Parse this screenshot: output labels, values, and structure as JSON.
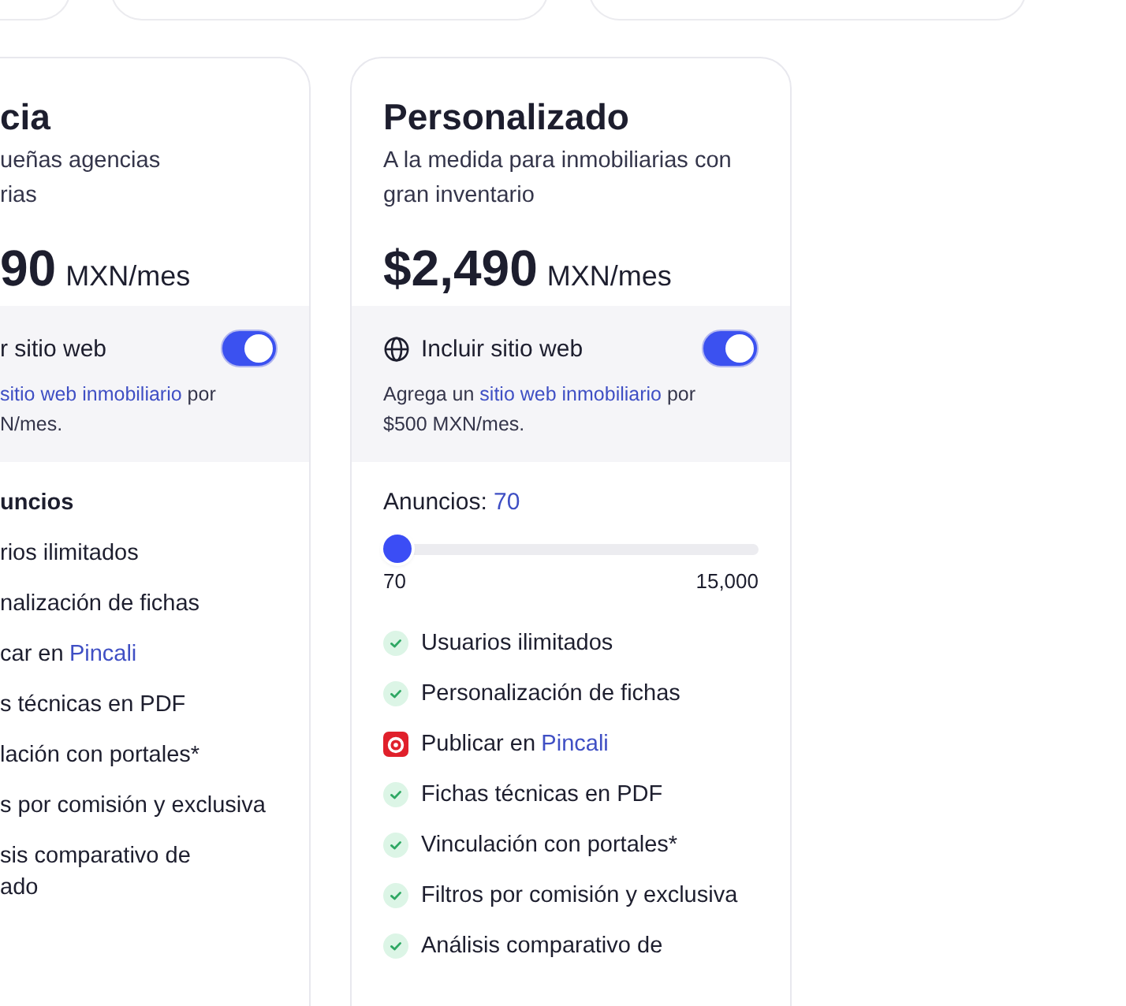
{
  "plans": [
    {
      "title": "cia",
      "description": [
        "ueñas agencias",
        "rias"
      ],
      "price": "90",
      "period": "MXN/mes",
      "website": {
        "label": "r sitio web",
        "icon": false,
        "on": true,
        "note": [
          [
            {
              "text": "sitio web inmobiliario",
              "link": true
            },
            {
              "text": " por",
              "link": false
            }
          ],
          [
            {
              "text": "N/mes.",
              "link": false
            }
          ]
        ]
      },
      "features": [
        {
          "kind": "heading",
          "text": "uncios"
        },
        {
          "kind": "plain",
          "text": "rios ilimitados"
        },
        {
          "kind": "plain",
          "text": "nalización de fichas"
        },
        {
          "kind": "plain",
          "text": "car en",
          "link": "Pincali"
        },
        {
          "kind": "plain",
          "text": "s técnicas en PDF"
        },
        {
          "kind": "plain",
          "text": "lación con portales*"
        },
        {
          "kind": "plain",
          "text": "s por comisión y exclusiva"
        },
        {
          "kind": "plain",
          "text": "sis comparativo de",
          "text2": "ado"
        }
      ]
    },
    {
      "title": "Personalizado",
      "description": [
        "A la medida para inmobiliarias con",
        "gran inventario"
      ],
      "price": "$2,490",
      "period": "MXN/mes",
      "website": {
        "label": "Incluir sitio web",
        "icon": true,
        "on": true,
        "note": [
          [
            {
              "text": "Agrega un ",
              "link": false
            },
            {
              "text": "sitio web inmobiliario",
              "link": true
            },
            {
              "text": " por",
              "link": false
            }
          ],
          [
            {
              "text": "$500 MXN/mes.",
              "link": false
            }
          ]
        ]
      },
      "ads": {
        "label": "Anuncios:",
        "value": "70",
        "level": 0,
        "min": "70",
        "max": "15,000"
      },
      "features": [
        {
          "kind": "check",
          "text": "Usuarios ilimitados"
        },
        {
          "kind": "check",
          "text": "Personalización de fichas"
        },
        {
          "kind": "pincali",
          "text": "Publicar en",
          "link": "Pincali"
        },
        {
          "kind": "check",
          "text": "Fichas técnicas en PDF"
        },
        {
          "kind": "check",
          "text": "Vinculación con portales*"
        },
        {
          "kind": "check",
          "text": "Filtros por comisión y exclusiva"
        },
        {
          "kind": "check",
          "text": "Análisis comparativo de"
        }
      ]
    }
  ]
}
